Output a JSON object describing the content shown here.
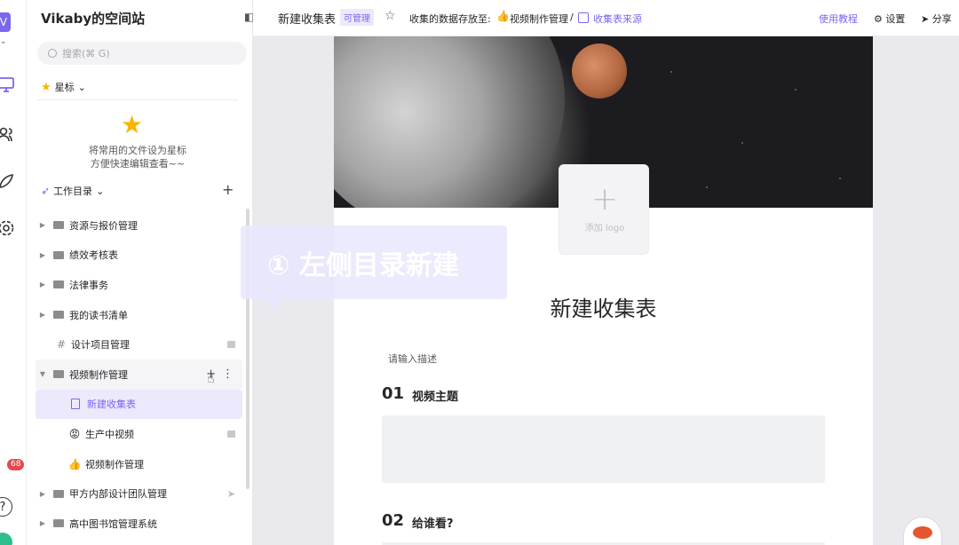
{
  "rail": {
    "avatar_letter": "V",
    "notification_count": "68",
    "help_label": "?"
  },
  "sidebar": {
    "space_title": "Vikaby的空间站",
    "search_placeholder": "搜索(⌘ G)",
    "starred_label": "星标",
    "starred_empty_line1": "将常用的文件设为星标",
    "starred_empty_line2": "方便快速编辑查看~~",
    "workdir_label": "工作目录",
    "tree": [
      {
        "label": "资源与报价管理",
        "type": "folder"
      },
      {
        "label": "绩效考核表",
        "type": "folder"
      },
      {
        "label": "法律事务",
        "type": "folder"
      },
      {
        "label": "我的读书清单",
        "type": "folder"
      },
      {
        "label": "设计项目管理",
        "type": "datasheet",
        "locked": true
      },
      {
        "label": "视频制作管理",
        "type": "folder-open"
      },
      {
        "label": "新建收集表",
        "type": "form",
        "active": true
      },
      {
        "label": "生产中视频",
        "type": "emoji",
        "emoji": "😡",
        "locked": true
      },
      {
        "label": "视频制作管理",
        "type": "emoji",
        "emoji": "👍"
      },
      {
        "label": "甲方内部设计团队管理",
        "type": "folder",
        "shared": true
      },
      {
        "label": "高中图书馆管理系统",
        "type": "folder"
      }
    ]
  },
  "topbar": {
    "title": "新建收集表",
    "tag": "可管理",
    "store_label": "收集的数据存放至:",
    "source_folder": "视频制作管理",
    "separator": "/",
    "source_sheet": "收集表来源",
    "tutorial": "使用教程",
    "settings": "设置",
    "share": "分享"
  },
  "form": {
    "logo_label": "添加 logo",
    "title": "新建收集表",
    "description_placeholder": "请输入描述",
    "questions": [
      {
        "num": "01",
        "title": "视频主题"
      },
      {
        "num": "02",
        "title": "给谁看?"
      }
    ]
  },
  "overlay": {
    "tip_text": "① 左侧目录新建"
  },
  "colors": {
    "accent": "#7b67ee",
    "star": "#f7b500",
    "badge": "#e5484d"
  }
}
